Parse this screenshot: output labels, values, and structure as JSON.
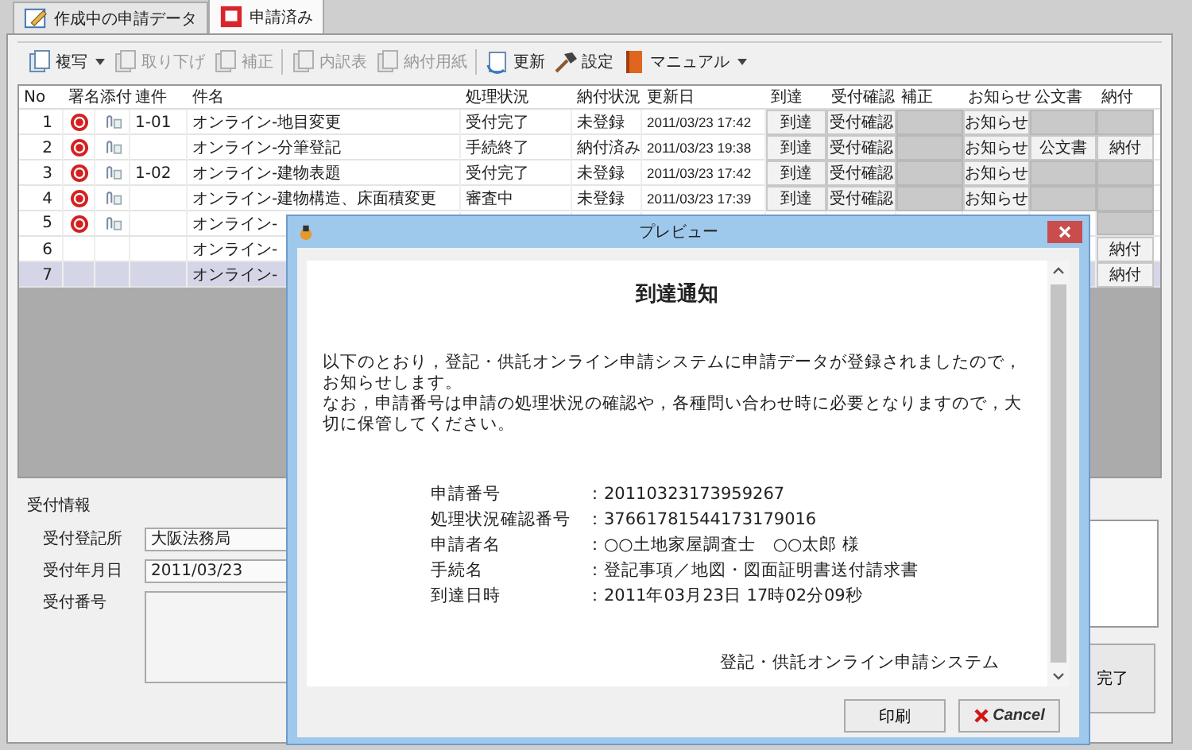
{
  "tabs": [
    {
      "label": "作成中の申請データ",
      "selected": false
    },
    {
      "label": "申請済み",
      "selected": true
    }
  ],
  "toolbar": [
    {
      "label": "複写",
      "disabled": false,
      "dropdown": true,
      "separator_before": false
    },
    {
      "label": "取り下げ",
      "disabled": true,
      "dropdown": false,
      "separator_before": false
    },
    {
      "label": "補正",
      "disabled": true,
      "dropdown": false,
      "separator_before": false
    },
    {
      "label": "内訳表",
      "disabled": true,
      "dropdown": false,
      "separator_before": true
    },
    {
      "label": "納付用紙",
      "disabled": true,
      "dropdown": false,
      "separator_before": false
    },
    {
      "label": "更新",
      "disabled": false,
      "dropdown": false,
      "separator_before": true
    },
    {
      "label": "設定",
      "disabled": false,
      "dropdown": false,
      "separator_before": false
    },
    {
      "label": "マニュアル",
      "disabled": false,
      "dropdown": true,
      "separator_before": false
    }
  ],
  "table": {
    "columns": [
      "No",
      "署名",
      "添付",
      "連件",
      "件名",
      "処理状況",
      "納付状況",
      "更新日",
      "到達",
      "受付確認",
      "補正",
      "お知らせ",
      "公文書",
      "納付"
    ],
    "rows": [
      {
        "no": "1",
        "signed": true,
        "attached": true,
        "renken": "1-01",
        "title": "オンライン-地目変更",
        "status": "受付完了",
        "payment_status": "未登録",
        "updated": "2011/03/23 17:42",
        "selected": false,
        "arrival": {
          "label": "到達",
          "enabled": true
        },
        "receipt": {
          "label": "受付確認",
          "enabled": true
        },
        "correction": {
          "enabled": false
        },
        "notice": {
          "label": "お知らせ",
          "enabled": true
        },
        "official": {
          "enabled": false
        },
        "payment": {
          "enabled": false
        }
      },
      {
        "no": "2",
        "signed": true,
        "attached": true,
        "title": "オンライン-分筆登記",
        "status": "手続終了",
        "payment_status": "納付済み",
        "updated": "2011/03/23 19:38",
        "selected": false,
        "arrival": {
          "label": "到達",
          "enabled": true
        },
        "receipt": {
          "label": "受付確認",
          "enabled": true
        },
        "correction": {
          "enabled": false
        },
        "notice": {
          "label": "お知らせ",
          "enabled": true
        },
        "official": {
          "label": "公文書",
          "enabled": true
        },
        "payment": {
          "label": "納付",
          "enabled": true
        }
      },
      {
        "no": "3",
        "signed": true,
        "attached": true,
        "renken": "1-02",
        "title": "オンライン-建物表題",
        "status": "受付完了",
        "payment_status": "未登録",
        "updated": "2011/03/23 17:42",
        "selected": false,
        "arrival": {
          "label": "到達",
          "enabled": true
        },
        "receipt": {
          "label": "受付確認",
          "enabled": true
        },
        "correction": {
          "enabled": false
        },
        "notice": {
          "label": "お知らせ",
          "enabled": true
        },
        "official": {
          "enabled": false
        },
        "payment": {
          "enabled": false
        }
      },
      {
        "no": "4",
        "signed": true,
        "attached": true,
        "title": "オンライン-建物構造、床面積変更",
        "status": "審査中",
        "payment_status": "未登録",
        "updated": "2011/03/23 17:39",
        "selected": false,
        "arrival": {
          "label": "到達",
          "enabled": true
        },
        "receipt": {
          "label": "受付確認",
          "enabled": true
        },
        "correction": {
          "enabled": false
        },
        "notice": {
          "label": "お知らせ",
          "enabled": true
        },
        "official": {
          "enabled": false
        },
        "payment": {
          "enabled": false
        }
      },
      {
        "no": "5",
        "signed": true,
        "attached": true,
        "title": "オンライン-",
        "selected": false,
        "payment": {
          "enabled": false
        }
      },
      {
        "no": "6",
        "signed": false,
        "attached": false,
        "title": "オンライン-",
        "selected": false,
        "payment": {
          "label": "納付",
          "enabled": true
        }
      },
      {
        "no": "7",
        "signed": false,
        "attached": false,
        "title": "オンライン-",
        "selected": true,
        "payment": {
          "label": "納付",
          "enabled": true
        }
      }
    ]
  },
  "reception": {
    "title": "受付情報",
    "fields": [
      {
        "label": "受付登記所",
        "value": "大阪法務局",
        "kind": "text"
      },
      {
        "label": "受付年月日",
        "value": "2011/03/23",
        "kind": "text"
      },
      {
        "label": "受付番号",
        "kind": "textarea"
      }
    ],
    "done_button": "完了"
  },
  "preview": {
    "title": "プレビュー",
    "heading": "到達通知",
    "paragraphs": [
      "以下のとおり，登記・供託オンライン申請システムに申請データが登録されましたので，お知らせします。",
      "なお，申請番号は申請の処理状況の確認や，各種問い合わせ時に必要となりますので，大切に保管してください。"
    ],
    "details": [
      {
        "label": "申請番号",
        "value": "：20110323173959267"
      },
      {
        "label": "処理状況確認番号",
        "value": "：37661781544173179016"
      },
      {
        "label": "申請者名",
        "value": "：○○土地家屋調査士　○○太郎 様"
      },
      {
        "label": "手続名",
        "value": "：登記事項／地図・図面証明書送付請求書"
      },
      {
        "label": "到達日時",
        "value": "：2011年03月23日 17時02分09秒"
      }
    ],
    "footer": "登記・供託オンライン申請システム",
    "buttons": [
      {
        "label": "印刷",
        "kind": "plain"
      },
      {
        "label": "Cancel",
        "kind": "cancel"
      }
    ]
  }
}
